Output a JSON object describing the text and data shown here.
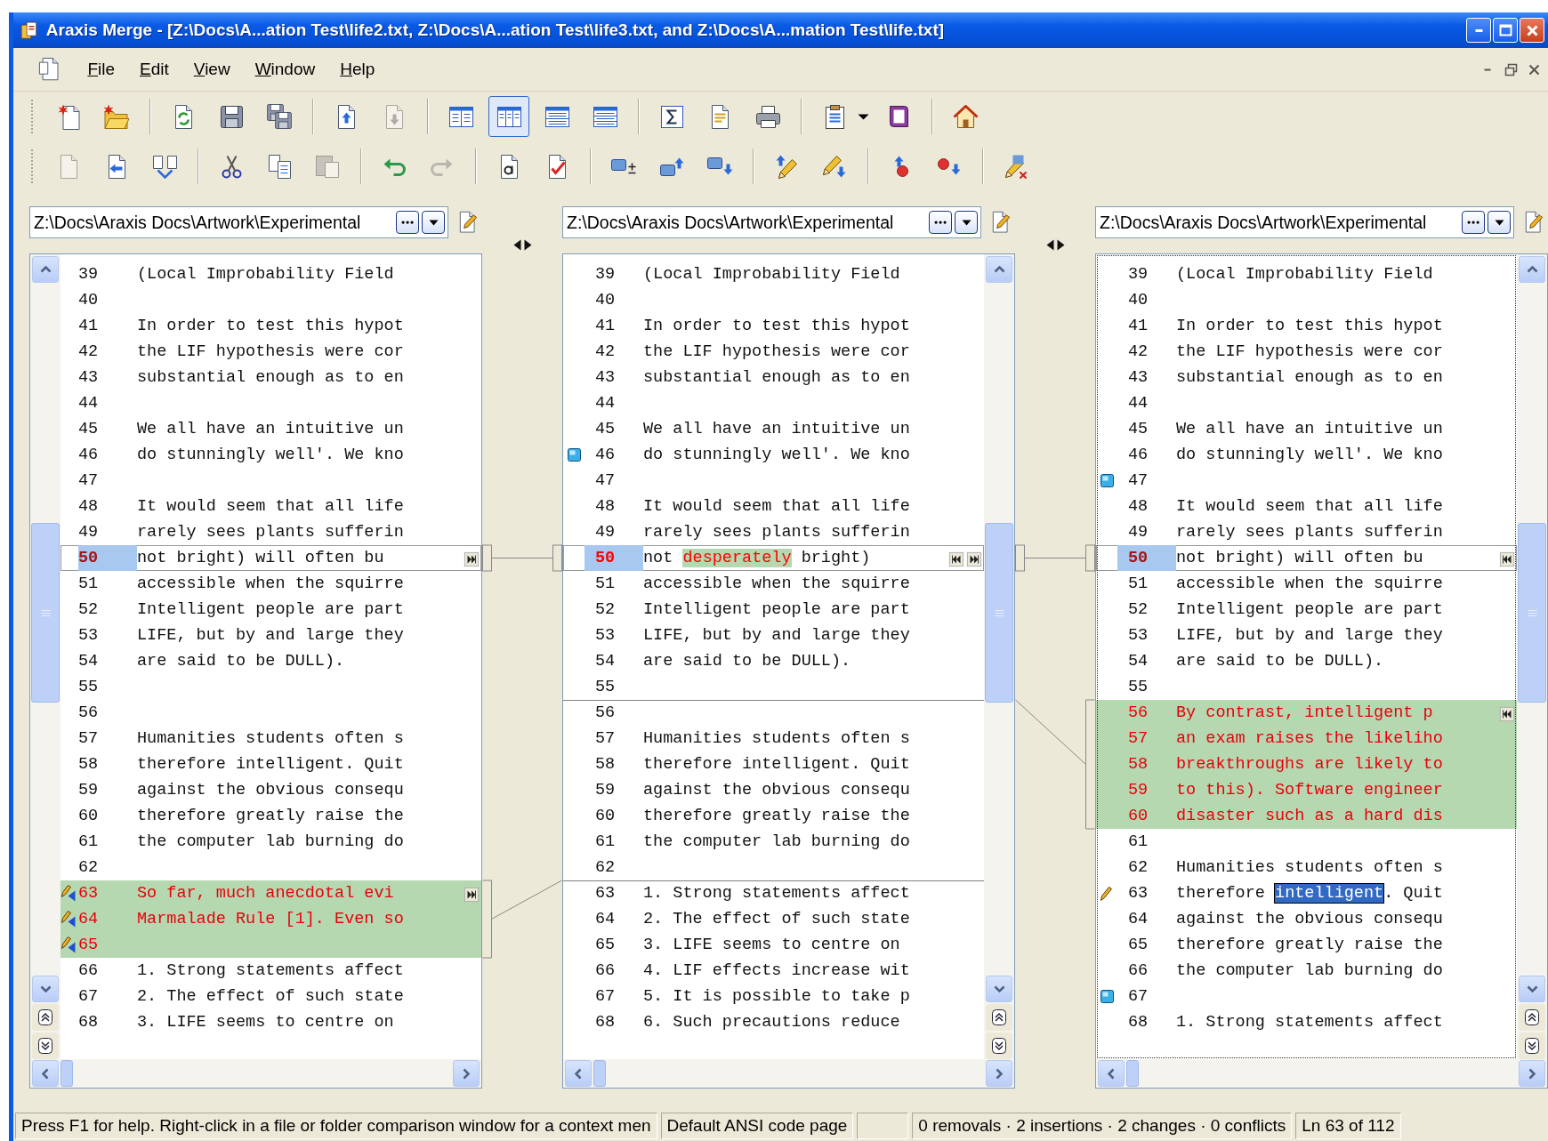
{
  "window": {
    "title": "Araxis Merge - [Z:\\Docs\\A...ation Test\\life2.txt, Z:\\Docs\\A...ation Test\\life3.txt, and Z:\\Docs\\A...mation Test\\life.txt]"
  },
  "menu": [
    {
      "label": "File"
    },
    {
      "label": "Edit"
    },
    {
      "label": "View"
    },
    {
      "label": "Window"
    },
    {
      "label": "Help"
    }
  ],
  "toolbars": [
    {
      "groups": [
        [
          {
            "kind": "new",
            "disabled": false,
            "selected": false
          },
          {
            "kind": "open",
            "disabled": false,
            "selected": false
          }
        ],
        [
          {
            "kind": "refresh",
            "disabled": false,
            "selected": false
          },
          {
            "kind": "save",
            "disabled": false,
            "selected": false
          },
          {
            "kind": "saveall",
            "disabled": false,
            "selected": false
          }
        ],
        [
          {
            "kind": "docup",
            "disabled": false,
            "selected": false
          },
          {
            "kind": "docdown",
            "disabled": true,
            "selected": false
          }
        ],
        [
          {
            "kind": "cols2",
            "disabled": false,
            "selected": false
          },
          {
            "kind": "cols3",
            "disabled": false,
            "selected": true
          },
          {
            "kind": "rows2",
            "disabled": false,
            "selected": false
          },
          {
            "kind": "rows3",
            "disabled": false,
            "selected": false
          }
        ],
        [
          {
            "kind": "sigma",
            "disabled": false,
            "selected": false
          },
          {
            "kind": "report",
            "disabled": false,
            "selected": false
          },
          {
            "kind": "print",
            "disabled": false,
            "selected": false
          }
        ],
        [
          {
            "kind": "props",
            "disabled": false,
            "selected": false
          },
          {
            "kind": "caret",
            "disabled": false,
            "selected": false
          },
          {
            "kind": "book",
            "disabled": false,
            "selected": false
          }
        ],
        [
          {
            "kind": "home",
            "disabled": false,
            "selected": false
          }
        ]
      ]
    },
    {
      "groups": [
        [
          {
            "kind": "blank",
            "disabled": true,
            "selected": false
          },
          {
            "kind": "docleft",
            "disabled": false,
            "selected": false
          },
          {
            "kind": "merge",
            "disabled": false,
            "selected": false
          }
        ],
        [
          {
            "kind": "cut",
            "disabled": false,
            "selected": false
          },
          {
            "kind": "copy",
            "disabled": false,
            "selected": false
          },
          {
            "kind": "paste",
            "disabled": true,
            "selected": false
          }
        ],
        [
          {
            "kind": "undo",
            "disabled": false,
            "selected": false
          },
          {
            "kind": "redo",
            "disabled": true,
            "selected": false
          }
        ],
        [
          {
            "kind": "textdoc",
            "disabled": false,
            "selected": false
          },
          {
            "kind": "checkdoc",
            "disabled": false,
            "selected": false
          }
        ],
        [
          {
            "kind": "addbox",
            "disabled": false,
            "selected": false
          },
          {
            "kind": "boxup",
            "disabled": false,
            "selected": false
          },
          {
            "kind": "boxdown",
            "disabled": false,
            "selected": false
          }
        ],
        [
          {
            "kind": "pencilup",
            "disabled": false,
            "selected": false
          },
          {
            "kind": "pencildown",
            "disabled": false,
            "selected": false
          }
        ],
        [
          {
            "kind": "dotup",
            "disabled": false,
            "selected": false
          },
          {
            "kind": "dotdown",
            "disabled": false,
            "selected": false
          }
        ],
        [
          {
            "kind": "erase",
            "disabled": false,
            "selected": false
          }
        ]
      ]
    }
  ],
  "panes": [
    {
      "path": "Z:\\Docs\\Araxis Docs\\Artwork\\Experimental",
      "focused": false,
      "scrollbar_left": true,
      "lines": [
        {
          "num": "39",
          "text": "(Local Improbability Field",
          "kind": "plain",
          "divider_above": false
        },
        {
          "num": "40",
          "kind": "plain",
          "divider_above": false
        },
        {
          "num": "41",
          "text": "In order to test this hypot",
          "kind": "plain",
          "divider_above": false
        },
        {
          "num": "42",
          "text": "the LIF hypothesis were cor",
          "kind": "plain",
          "divider_above": false
        },
        {
          "num": "43",
          "text": "substantial enough as to en",
          "kind": "plain",
          "divider_above": false
        },
        {
          "num": "44",
          "kind": "plain",
          "divider_above": false
        },
        {
          "num": "45",
          "text": "We all have an intuitive un",
          "kind": "plain",
          "divider_above": false
        },
        {
          "num": "46",
          "text": "do stunningly well'. We kno",
          "kind": "plain",
          "divider_above": false
        },
        {
          "num": "47",
          "kind": "plain",
          "divider_above": false
        },
        {
          "num": "48",
          "text": "It would seem that all life",
          "kind": "plain",
          "divider_above": false
        },
        {
          "num": "49",
          "text": "rarely sees plants sufferin",
          "kind": "plain",
          "divider_above": false
        },
        {
          "num": "50",
          "text": "not bright) will often bu",
          "kind": "current",
          "arrows": [
            {
              "kind": "right"
            }
          ]
        },
        {
          "num": "51",
          "text": "accessible when the squirre",
          "kind": "plain",
          "divider_above": false
        },
        {
          "num": "52",
          "text": "Intelligent people are part",
          "kind": "plain",
          "divider_above": false
        },
        {
          "num": "53",
          "text": "LIFE, but by and large they",
          "kind": "plain",
          "divider_above": false
        },
        {
          "num": "54",
          "text": "are said to be DULL).",
          "kind": "plain",
          "divider_above": false
        },
        {
          "num": "55",
          "kind": "plain",
          "divider_above": false
        },
        {
          "num": "56",
          "kind": "plain",
          "divider_above": false
        },
        {
          "num": "57",
          "text": "Humanities students often s",
          "kind": "plain",
          "divider_above": false
        },
        {
          "num": "58",
          "text": "therefore intelligent. Quit",
          "kind": "plain",
          "divider_above": false
        },
        {
          "num": "59",
          "text": "against the obvious consequ",
          "kind": "plain",
          "divider_above": false
        },
        {
          "num": "60",
          "text": "therefore greatly raise the",
          "kind": "plain",
          "divider_above": false
        },
        {
          "num": "61",
          "text": "the computer lab burning do",
          "kind": "plain",
          "divider_above": false
        },
        {
          "num": "62",
          "kind": "plain",
          "divider_above": false
        },
        {
          "num": "63",
          "text": "So far, much anecdotal evi",
          "kind": "inserted",
          "marker": {
            "kind": "edit-merge"
          },
          "arrows": [
            {
              "kind": "right"
            }
          ]
        },
        {
          "num": "64",
          "text": "Marmalade Rule [1]. Even so",
          "kind": "inserted",
          "marker": {
            "kind": "edit-merge"
          }
        },
        {
          "num": "65",
          "kind": "inserted",
          "marker": {
            "kind": "edit-merge"
          }
        },
        {
          "num": "66",
          "text": "1. Strong statements affect",
          "kind": "plain",
          "divider_above": false
        },
        {
          "num": "67",
          "text": "2. The effect of such state",
          "kind": "plain",
          "divider_above": false
        },
        {
          "num": "68",
          "text": "3. LIFE seems to centre on",
          "kind": "plain",
          "divider_above": false
        }
      ]
    },
    {
      "path": "Z:\\Docs\\Araxis Docs\\Artwork\\Experimental",
      "focused": false,
      "scrollbar_left": false,
      "lines": [
        {
          "num": "39",
          "text": "(Local Improbability Field",
          "kind": "plain",
          "divider_above": false
        },
        {
          "num": "40",
          "kind": "plain",
          "divider_above": false
        },
        {
          "num": "41",
          "text": "In order to test this hypot",
          "kind": "plain",
          "divider_above": false
        },
        {
          "num": "42",
          "text": "the LIF hypothesis were cor",
          "kind": "plain",
          "divider_above": false
        },
        {
          "num": "43",
          "text": "substantial enough as to en",
          "kind": "plain",
          "divider_above": false
        },
        {
          "num": "44",
          "kind": "plain",
          "divider_above": false
        },
        {
          "num": "45",
          "text": "We all have an intuitive un",
          "kind": "plain",
          "divider_above": false
        },
        {
          "num": "46",
          "text": "do stunningly well'. We kno",
          "kind": "plain",
          "divider_above": false,
          "marker": {
            "kind": "bookmark"
          }
        },
        {
          "num": "47",
          "kind": "plain",
          "divider_above": false
        },
        {
          "num": "48",
          "text": "It would seem that all life",
          "kind": "plain",
          "divider_above": false
        },
        {
          "num": "49",
          "text": "rarely sees plants sufferin",
          "kind": "plain",
          "divider_above": false
        },
        {
          "num": "50",
          "segments": [
            {
              "text": "not ",
              "kind": "plain"
            },
            {
              "text": "desperately",
              "kind": "inserted"
            },
            {
              "text": " bright)",
              "kind": "plain"
            }
          ],
          "kind": "current",
          "arrows": [
            {
              "kind": "left"
            },
            {
              "kind": "right"
            }
          ]
        },
        {
          "num": "51",
          "text": "accessible when the squirre",
          "kind": "plain",
          "divider_above": false
        },
        {
          "num": "52",
          "text": "Intelligent people are part",
          "kind": "plain",
          "divider_above": false
        },
        {
          "num": "53",
          "text": "LIFE, but by and large they",
          "kind": "plain",
          "divider_above": false
        },
        {
          "num": "54",
          "text": "are said to be DULL).",
          "kind": "plain",
          "divider_above": false
        },
        {
          "num": "55",
          "kind": "plain",
          "divider_above": false
        },
        {
          "num": "56",
          "kind": "plain",
          "divider_above": true
        },
        {
          "num": "57",
          "text": "Humanities students often s",
          "kind": "plain",
          "divider_above": false
        },
        {
          "num": "58",
          "text": "therefore intelligent. Quit",
          "kind": "plain",
          "divider_above": false
        },
        {
          "num": "59",
          "text": "against the obvious consequ",
          "kind": "plain",
          "divider_above": false
        },
        {
          "num": "60",
          "text": "therefore greatly raise the",
          "kind": "plain",
          "divider_above": false
        },
        {
          "num": "61",
          "text": "the computer lab burning do",
          "kind": "plain",
          "divider_above": false
        },
        {
          "num": "62",
          "kind": "plain",
          "divider_above": false
        },
        {
          "num": "63",
          "text": "1. Strong statements affect",
          "kind": "plain",
          "divider_above": true
        },
        {
          "num": "64",
          "text": "2. The effect of such state",
          "kind": "plain",
          "divider_above": false
        },
        {
          "num": "65",
          "text": "3. LIFE seems to centre on",
          "kind": "plain",
          "divider_above": false
        },
        {
          "num": "66",
          "text": "4. LIF effects increase wit",
          "kind": "plain",
          "divider_above": false
        },
        {
          "num": "67",
          "text": "5. It is possible to take p",
          "kind": "plain",
          "divider_above": false
        },
        {
          "num": "68",
          "text": "6. Such precautions reduce",
          "kind": "plain",
          "divider_above": false
        }
      ]
    },
    {
      "path": "Z:\\Docs\\Araxis Docs\\Artwork\\Experimental",
      "focused": true,
      "scrollbar_left": false,
      "lines": [
        {
          "num": "39",
          "text": "(Local Improbability Field",
          "kind": "plain",
          "divider_above": false
        },
        {
          "num": "40",
          "kind": "plain",
          "divider_above": false
        },
        {
          "num": "41",
          "text": "In order to test this hypot",
          "kind": "plain",
          "divider_above": false
        },
        {
          "num": "42",
          "text": "the LIF hypothesis were cor",
          "kind": "plain",
          "divider_above": false
        },
        {
          "num": "43",
          "text": "substantial enough as to en",
          "kind": "plain",
          "divider_above": false
        },
        {
          "num": "44",
          "kind": "plain",
          "divider_above": false
        },
        {
          "num": "45",
          "text": "We all have an intuitive un",
          "kind": "plain",
          "divider_above": false
        },
        {
          "num": "46",
          "text": "do stunningly well'. We kno",
          "kind": "plain",
          "divider_above": false
        },
        {
          "num": "47",
          "kind": "plain",
          "divider_above": false,
          "marker": {
            "kind": "bookmark"
          }
        },
        {
          "num": "48",
          "text": "It would seem that all life",
          "kind": "plain",
          "divider_above": false
        },
        {
          "num": "49",
          "text": "rarely sees plants sufferin",
          "kind": "plain",
          "divider_above": false
        },
        {
          "num": "50",
          "text": "not bright) will often bu",
          "kind": "current",
          "arrows": [
            {
              "kind": "left"
            }
          ]
        },
        {
          "num": "51",
          "text": "accessible when the squirre",
          "kind": "plain",
          "divider_above": false
        },
        {
          "num": "52",
          "text": "Intelligent people are part",
          "kind": "plain",
          "divider_above": false
        },
        {
          "num": "53",
          "text": "LIFE, but by and large they",
          "kind": "plain",
          "divider_above": false
        },
        {
          "num": "54",
          "text": "are said to be DULL).",
          "kind": "plain",
          "divider_above": false
        },
        {
          "num": "55",
          "kind": "plain",
          "divider_above": false
        },
        {
          "num": "56",
          "text": "By contrast, intelligent p",
          "kind": "inserted",
          "arrows": [
            {
              "kind": "left"
            }
          ]
        },
        {
          "num": "57",
          "text": "an exam raises the likeliho",
          "kind": "inserted"
        },
        {
          "num": "58",
          "text": "breakthroughs are likely to",
          "kind": "inserted"
        },
        {
          "num": "59",
          "text": "to this). Software engineer",
          "kind": "inserted"
        },
        {
          "num": "60",
          "text": "disaster such as a hard dis",
          "kind": "inserted"
        },
        {
          "num": "61",
          "kind": "plain",
          "divider_above": false
        },
        {
          "num": "62",
          "text": "Humanities students often s",
          "kind": "plain",
          "divider_above": false
        },
        {
          "num": "63",
          "segments": [
            {
              "text": "therefore ",
              "kind": "plain"
            },
            {
              "text": "intelligent",
              "kind": "selected"
            },
            {
              "text": ". Quit",
              "kind": "plain"
            }
          ],
          "kind": "plain",
          "divider_above": false,
          "marker": {
            "kind": "edit"
          }
        },
        {
          "num": "64",
          "text": "against the obvious consequ",
          "kind": "plain",
          "divider_above": false
        },
        {
          "num": "65",
          "text": "therefore greatly raise the",
          "kind": "plain",
          "divider_above": false
        },
        {
          "num": "66",
          "text": "the computer lab burning do",
          "kind": "plain",
          "divider_above": false
        },
        {
          "num": "67",
          "kind": "plain",
          "divider_above": false,
          "marker": {
            "kind": "bookmark"
          }
        },
        {
          "num": "68",
          "text": "1. Strong statements affect",
          "kind": "plain",
          "divider_above": false
        }
      ]
    }
  ],
  "status_bar": {
    "help": "Press F1 for help. Right-click in a file or folder comparison window for a context men",
    "encoding": "Default ANSI code page",
    "summary": "0 removals · 2 insertions · 2 changes · 0 conflicts",
    "position": "Ln 63 of 112"
  }
}
